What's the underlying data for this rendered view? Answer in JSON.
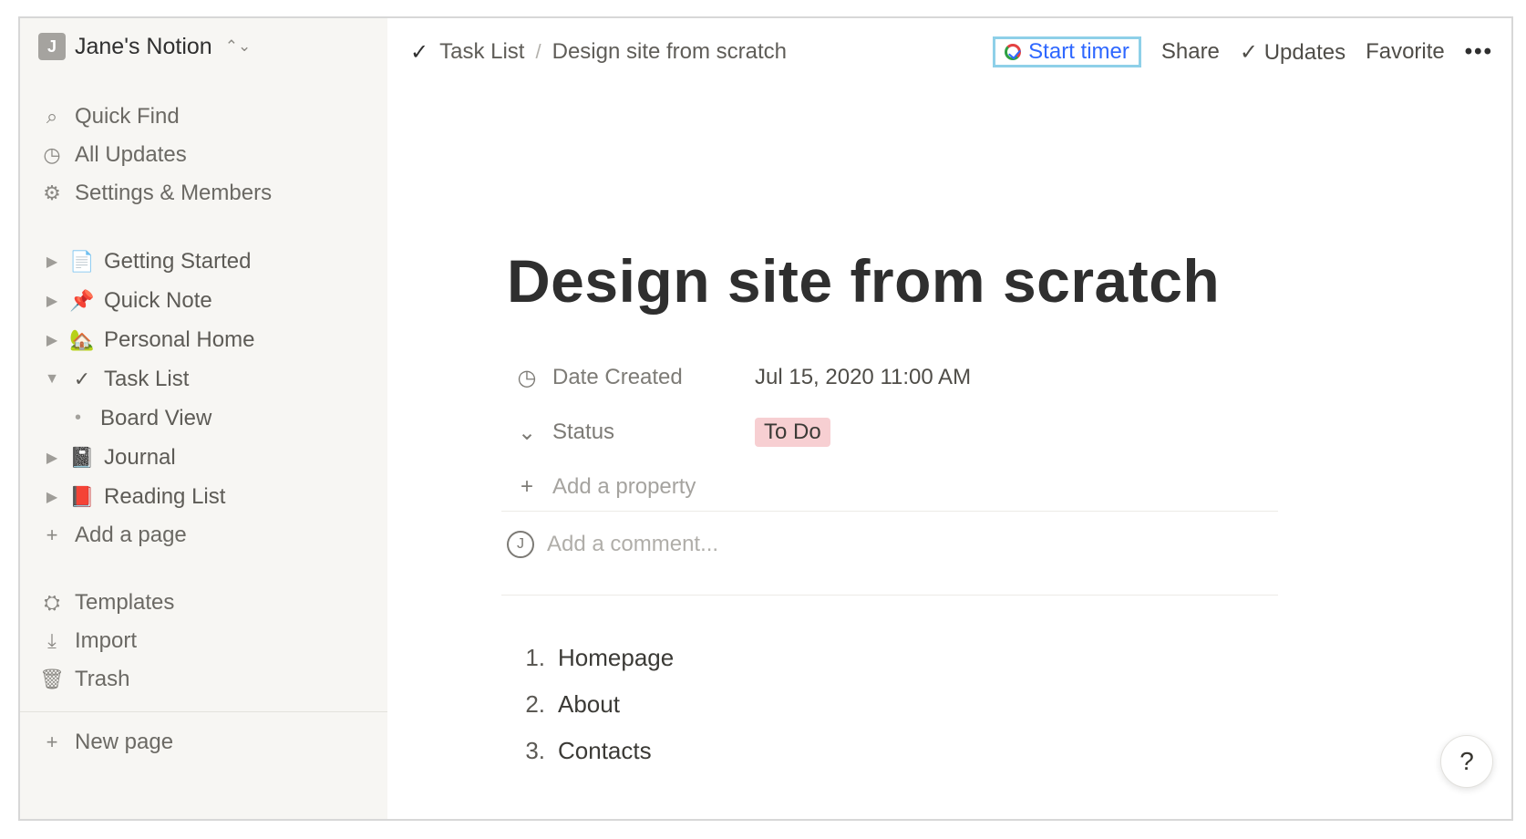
{
  "sidebar": {
    "workspace": {
      "avatar_letter": "J",
      "name": "Jane's Notion",
      "chevron": "⌃⌄"
    },
    "nav_items": [
      {
        "icon": "search-icon",
        "glyph": "⌕",
        "label": "Quick Find"
      },
      {
        "icon": "clock-icon",
        "glyph": "◷",
        "label": "All Updates"
      },
      {
        "icon": "gear-icon",
        "glyph": "⚙",
        "label": "Settings & Members"
      }
    ],
    "pages": [
      {
        "toggle": "▶",
        "emoji": "📄",
        "emoji_name": "document-icon",
        "label": "Getting Started"
      },
      {
        "toggle": "▶",
        "emoji": "📌",
        "emoji_name": "pin-icon",
        "label": "Quick Note"
      },
      {
        "toggle": "▶",
        "emoji": "🏡",
        "emoji_name": "home-icon",
        "label": "Personal Home"
      },
      {
        "toggle": "▼",
        "emoji": "✓",
        "emoji_name": "check-icon",
        "label": "Task List"
      },
      {
        "bullet": "•",
        "label": "Board View"
      },
      {
        "toggle": "▶",
        "emoji": "📓",
        "emoji_name": "notebook-icon",
        "label": "Journal"
      },
      {
        "toggle": "▶",
        "emoji": "📕",
        "emoji_name": "book-icon",
        "label": "Reading List"
      }
    ],
    "add_page": {
      "icon": "plus-icon",
      "glyph": "+",
      "label": "Add a page"
    },
    "bottom_items": [
      {
        "icon": "templates-icon",
        "glyph": "⛭",
        "label": "Templates"
      },
      {
        "icon": "import-icon",
        "glyph": "⤓",
        "label": "Import"
      },
      {
        "icon": "trash-icon",
        "glyph": "🗑",
        "label": "Trash"
      }
    ],
    "new_page": {
      "icon": "plus-icon",
      "glyph": "+",
      "label": "New page"
    }
  },
  "topbar": {
    "breadcrumb_icon": "✓",
    "breadcrumb": [
      "Task List",
      "Design site from scratch"
    ],
    "separator": "/",
    "start_timer": "Start timer",
    "share": "Share",
    "updates_icon": "✓",
    "updates": "Updates",
    "favorite": "Favorite",
    "more": "•••"
  },
  "page": {
    "title": "Design site from scratch",
    "properties": [
      {
        "icon": "clock-icon",
        "glyph": "◷",
        "label": "Date Created",
        "value": "Jul 15, 2020 11:00 AM"
      },
      {
        "icon": "status-icon",
        "glyph": "⌄",
        "label": "Status",
        "value": "To Do"
      }
    ],
    "add_property": {
      "glyph": "+",
      "label": "Add a property"
    },
    "comment": {
      "avatar": "J",
      "placeholder": "Add a comment..."
    },
    "list": [
      {
        "num": "1.",
        "text": "Homepage"
      },
      {
        "num": "2.",
        "text": "About"
      },
      {
        "num": "3.",
        "text": "Contacts"
      }
    ]
  },
  "help": "?",
  "colors": {
    "sidebar_bg": "#f7f6f3",
    "accent_blue": "#2e67ff",
    "timer_border": "#8ed0e8",
    "status_pink": "#f7cfd2"
  }
}
